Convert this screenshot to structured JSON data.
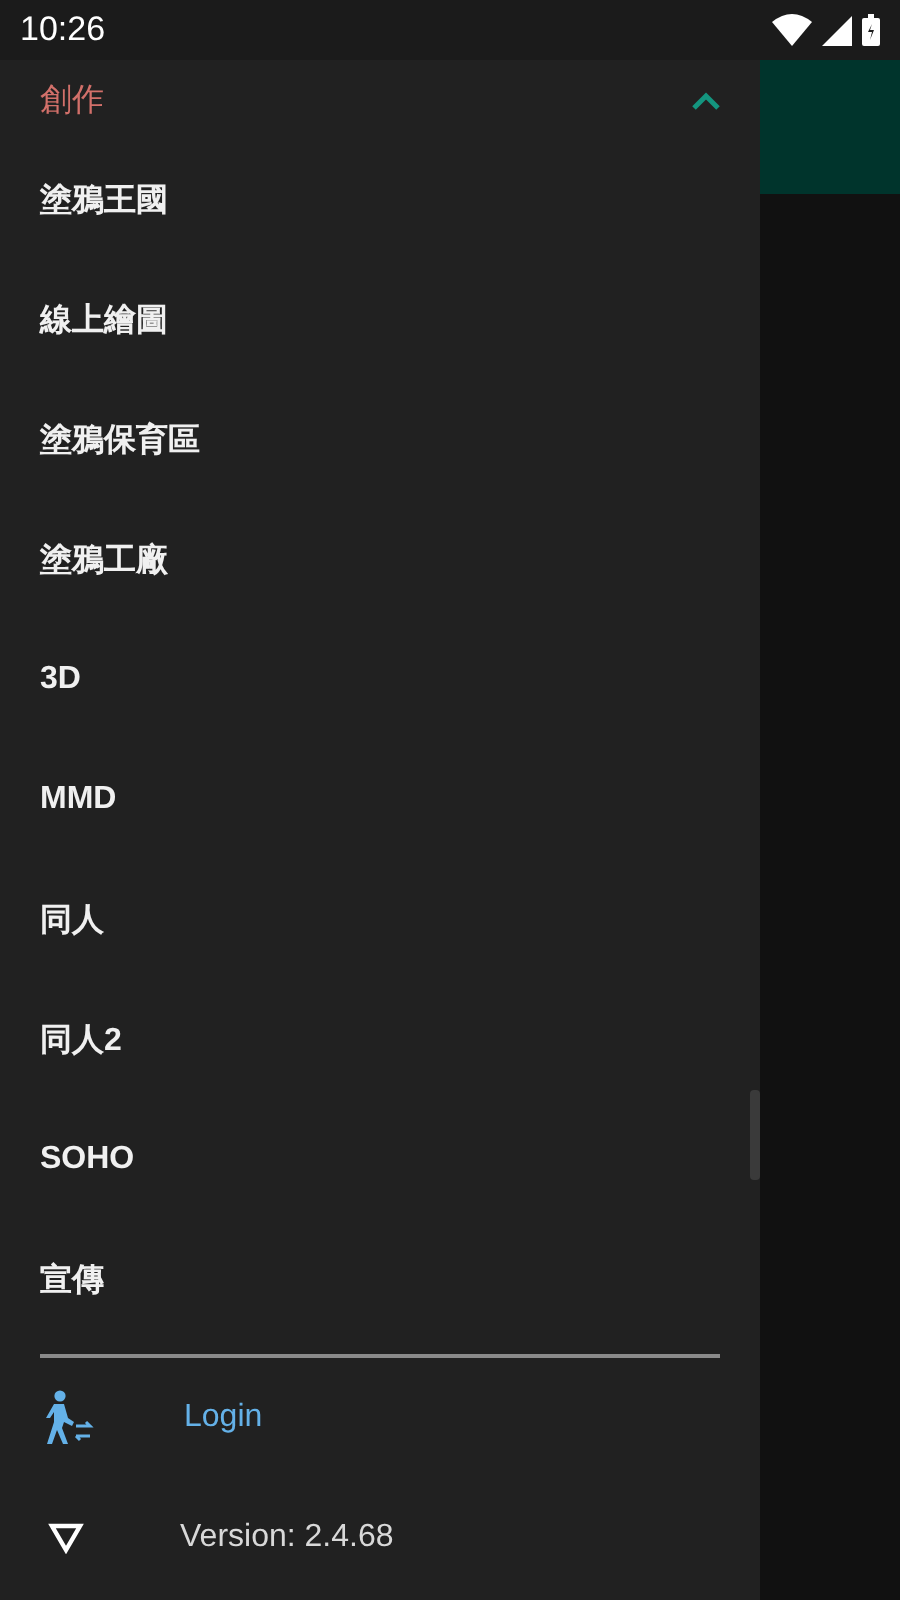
{
  "status_bar": {
    "time": "10:26"
  },
  "drawer": {
    "section": {
      "title": "創作",
      "expanded": true
    },
    "items": [
      {
        "label": "塗鴉王國"
      },
      {
        "label": "線上繪圖"
      },
      {
        "label": "塗鴉保育區"
      },
      {
        "label": "塗鴉工廠"
      },
      {
        "label": "3D"
      },
      {
        "label": "MMD"
      },
      {
        "label": "同人"
      },
      {
        "label": "同人2"
      },
      {
        "label": "SOHO"
      },
      {
        "label": "宣傳"
      }
    ],
    "login": {
      "label": "Login"
    },
    "version": "Version: 2.4.68"
  }
}
